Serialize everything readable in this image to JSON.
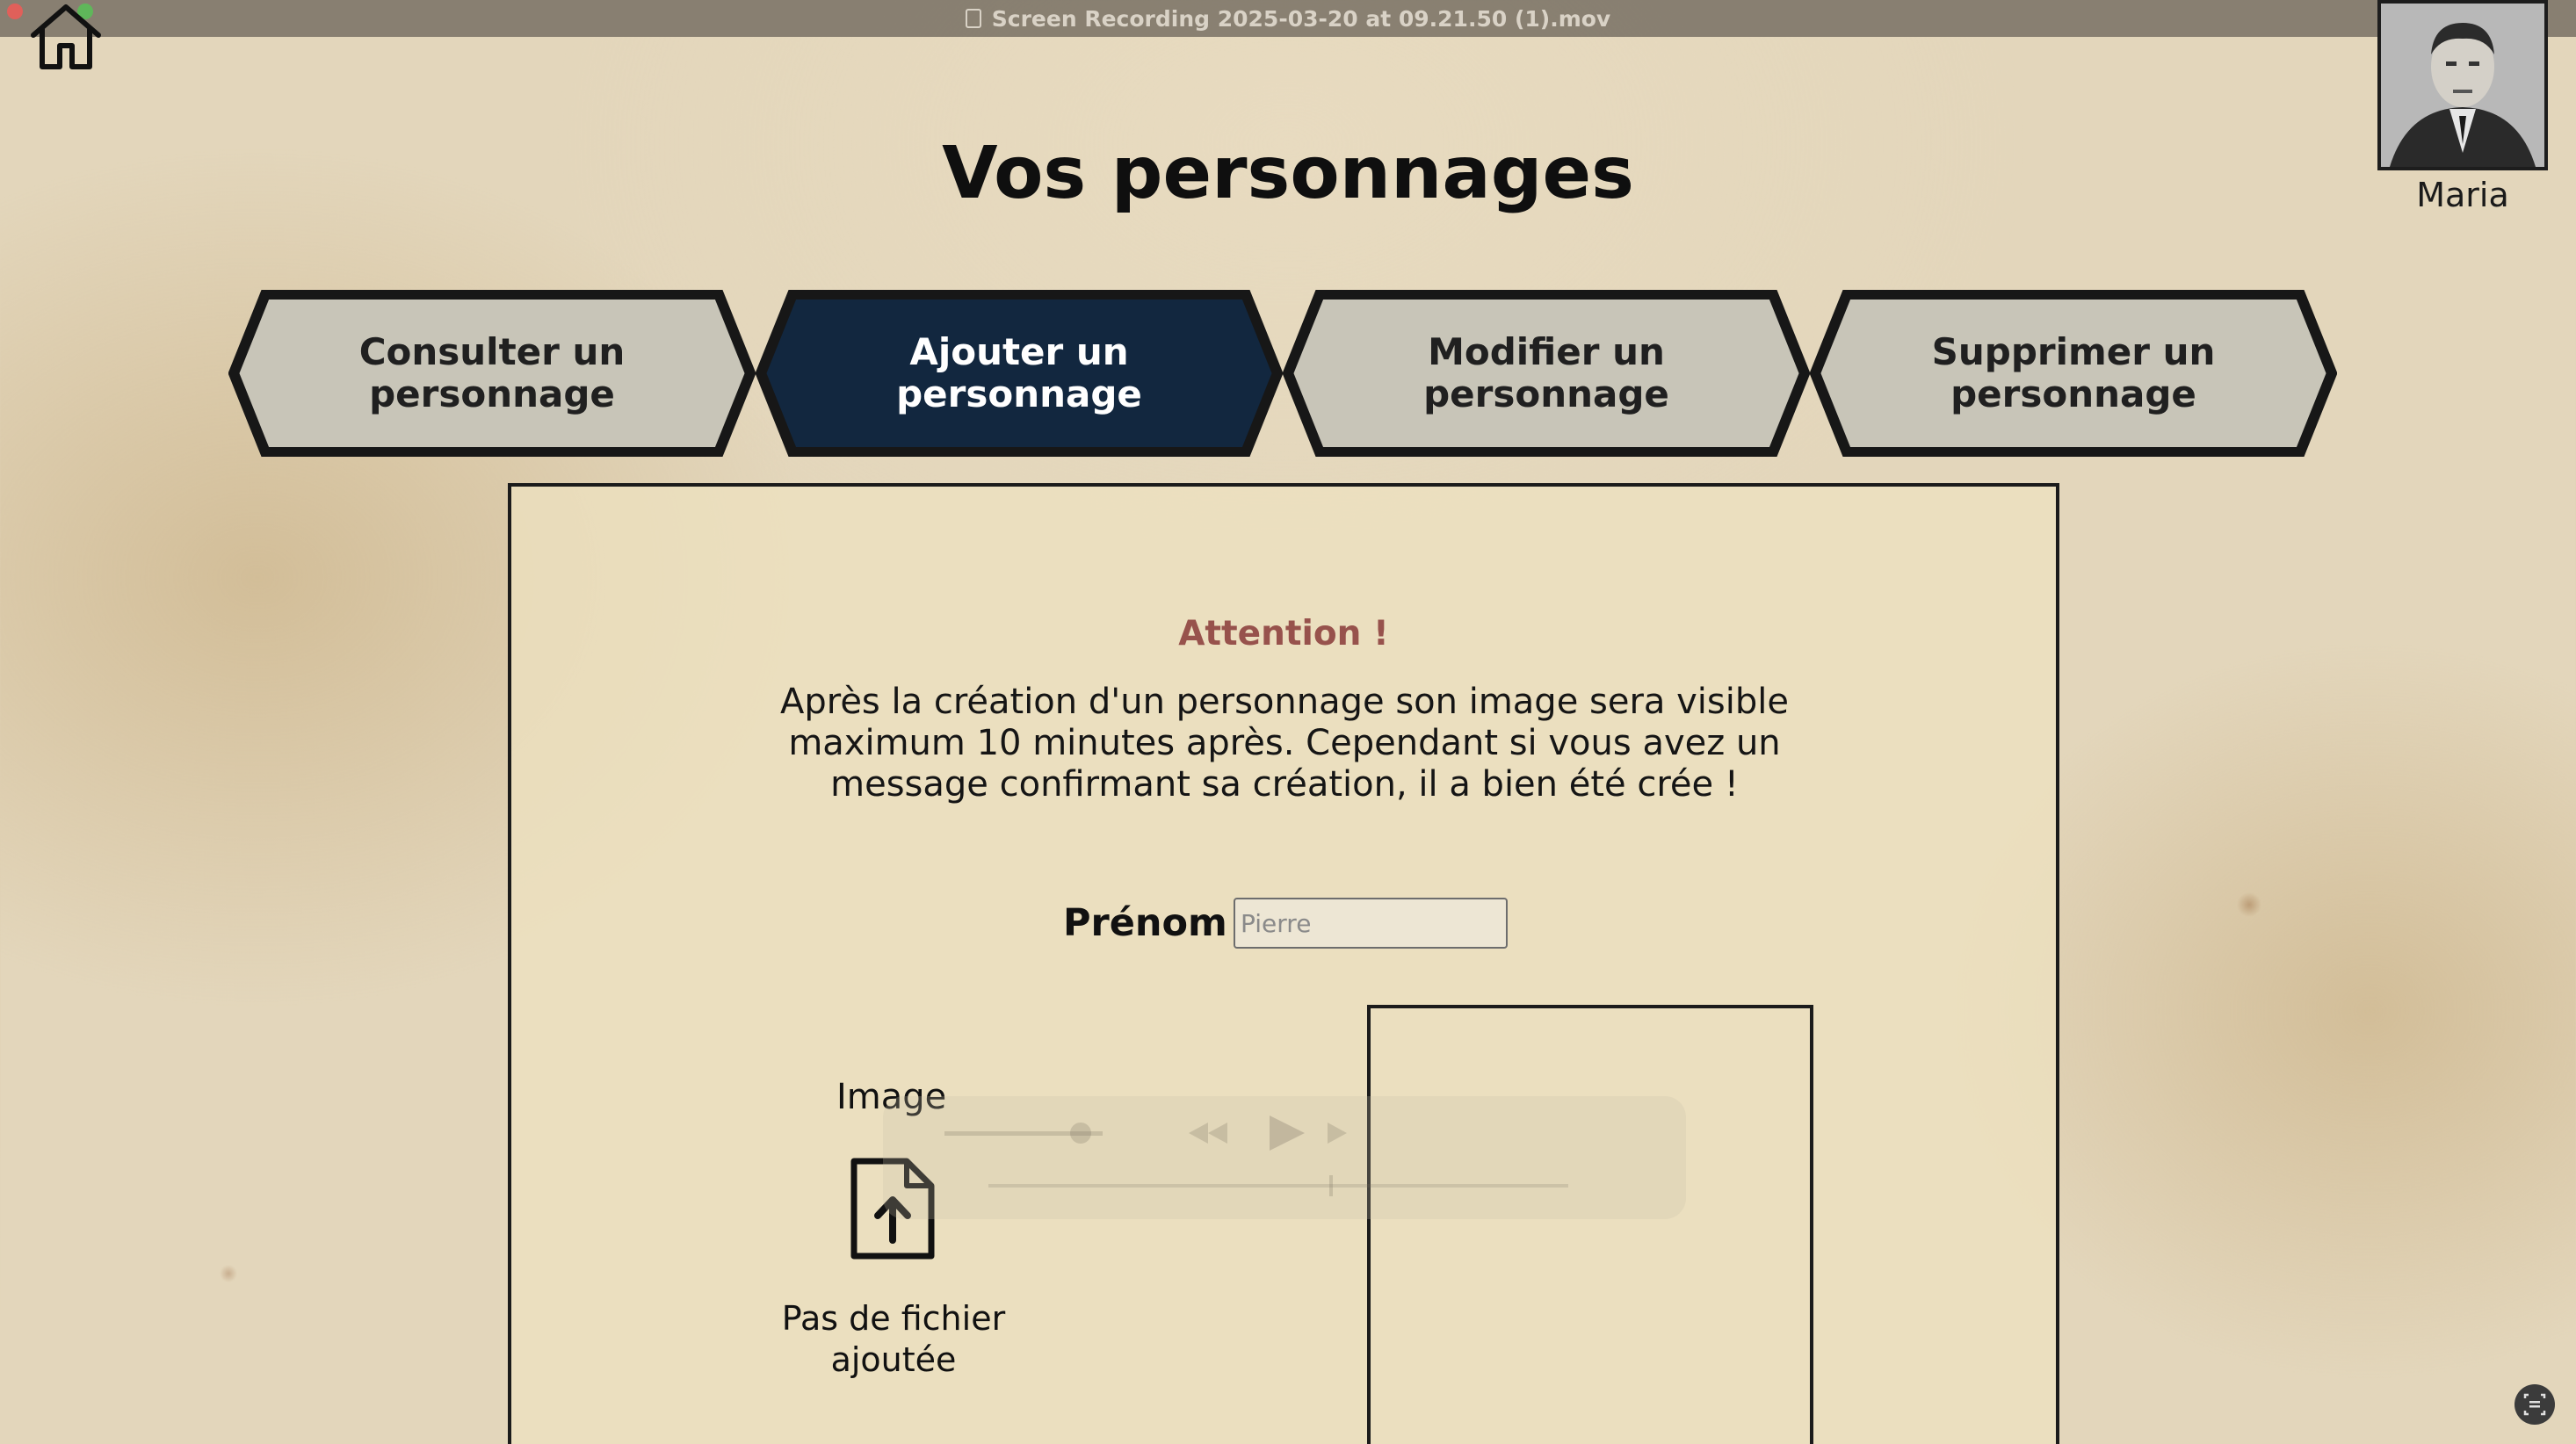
{
  "titlebar": {
    "title": "Screen Recording 2025-03-20 at 09.21.50 (1).mov"
  },
  "header": {
    "home_icon": "home-icon",
    "title": "Vos personnages"
  },
  "profile": {
    "name": "Maria"
  },
  "tabs": [
    {
      "label": "Consulter un personnage",
      "active": false
    },
    {
      "label": "Ajouter un personnage",
      "active": true
    },
    {
      "label": "Modifier un personnage",
      "active": false
    },
    {
      "label": "Supprimer un personnage",
      "active": false
    }
  ],
  "form": {
    "attention_title": "Attention !",
    "attention_text": "Après la création d'un personnage son image sera visible maximum 10 minutes après. Cependant si vous avez un message confirmant sa création, il a bien été crée !",
    "prenom_label": "Prénom",
    "prenom_placeholder": "Pierre",
    "image_label": "Image",
    "upload_icon": "file-upload-icon",
    "file_status": "Pas de fichier ajoutée"
  },
  "colors": {
    "active_tab": "#12273f",
    "inactive_tab": "#c8c5b8",
    "tab_border": "#171717",
    "attention": "#97524c",
    "background": "#e3d6bb"
  }
}
